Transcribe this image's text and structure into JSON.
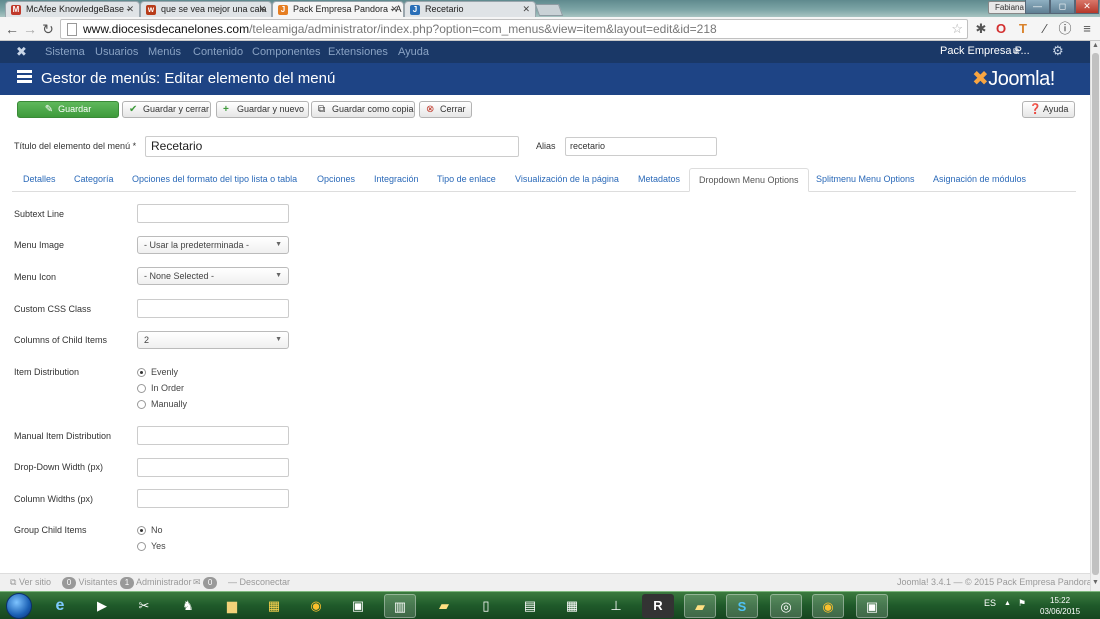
{
  "browser": {
    "tabs": [
      {
        "title": "McAfee KnowledgeBase -",
        "icon": "mcafee-icon",
        "color": "#c0392b"
      },
      {
        "title": "que se vea mejor una cala",
        "icon": "w-icon",
        "color": "#b83c1a"
      },
      {
        "title": "Pack Empresa Pandora - A",
        "icon": "joomla-icon",
        "color": "#e67e22"
      },
      {
        "title": "Recetario",
        "icon": "joomla-icon",
        "color": "#2a6fb8"
      }
    ],
    "user_tag": "Fabiana",
    "window_controls": [
      "—",
      "◻",
      "✕"
    ],
    "url_host": "www.diocesisdecanelones.com",
    "url_path": "/teleamiga/administrator/index.php?option=com_menus&view=item&layout=edit&id=218"
  },
  "admin_nav": {
    "items": [
      "Sistema",
      "Usuarios",
      "Menús",
      "Contenido",
      "Componentes",
      "Extensiones",
      "Ayuda"
    ],
    "site_name": "Pack Empresa P...",
    "accent": "#1a3867"
  },
  "header": {
    "title": "Gestor de menús: Editar elemento del menú",
    "brand": "Joomla!",
    "bg": "#1e4485"
  },
  "toolbar": {
    "save": "Guardar",
    "save_close": "Guardar y cerrar",
    "save_new": "Guardar y nuevo",
    "save_copy": "Guardar como copia",
    "close": "Cerrar",
    "help": "Ayuda"
  },
  "form": {
    "title_label": "Título del elemento del menú *",
    "title_value": "Recetario",
    "alias_label": "Alias",
    "alias_value": "recetario",
    "tabs": [
      "Detalles",
      "Categoría",
      "Opciones del formato del tipo lista o tabla",
      "Opciones",
      "Integración",
      "Tipo de enlace",
      "Visualización de la página",
      "Metadatos",
      "Dropdown Menu Options",
      "Splitmenu Menu Options",
      "Asignación de módulos"
    ],
    "active_tab": "Dropdown Menu Options",
    "fields": {
      "subtext_line": {
        "label": "Subtext Line",
        "value": ""
      },
      "menu_image": {
        "label": "Menu Image",
        "value": "- Usar la predeterminada -"
      },
      "menu_icon": {
        "label": "Menu Icon",
        "value": "- None Selected -"
      },
      "custom_css": {
        "label": "Custom CSS Class",
        "value": ""
      },
      "columns": {
        "label": "Columns of Child Items",
        "value": "2"
      },
      "item_distribution": {
        "label": "Item Distribution",
        "options": [
          "Evenly",
          "In Order",
          "Manually"
        ],
        "selected": "Evenly"
      },
      "manual_distribution": {
        "label": "Manual Item Distribution",
        "value": ""
      },
      "dropdown_width": {
        "label": "Drop-Down Width (px)",
        "value": ""
      },
      "column_widths": {
        "label": "Column Widths (px)",
        "value": ""
      },
      "group_child": {
        "label": "Group Child Items",
        "options": [
          "No",
          "Yes"
        ],
        "selected": "No"
      }
    }
  },
  "status": {
    "view_site": "Ver sitio",
    "visitors_count": "0",
    "visitors": "Visitantes",
    "admins_count": "1",
    "admins": "Administrador",
    "messages_count": "0",
    "logout": "Desconectar",
    "version": "Joomla! 3.4.1 — © 2015 Pack Empresa Pandora"
  },
  "taskbar": {
    "lang": "ES",
    "time": "15:22",
    "date": "03/06/2015"
  }
}
